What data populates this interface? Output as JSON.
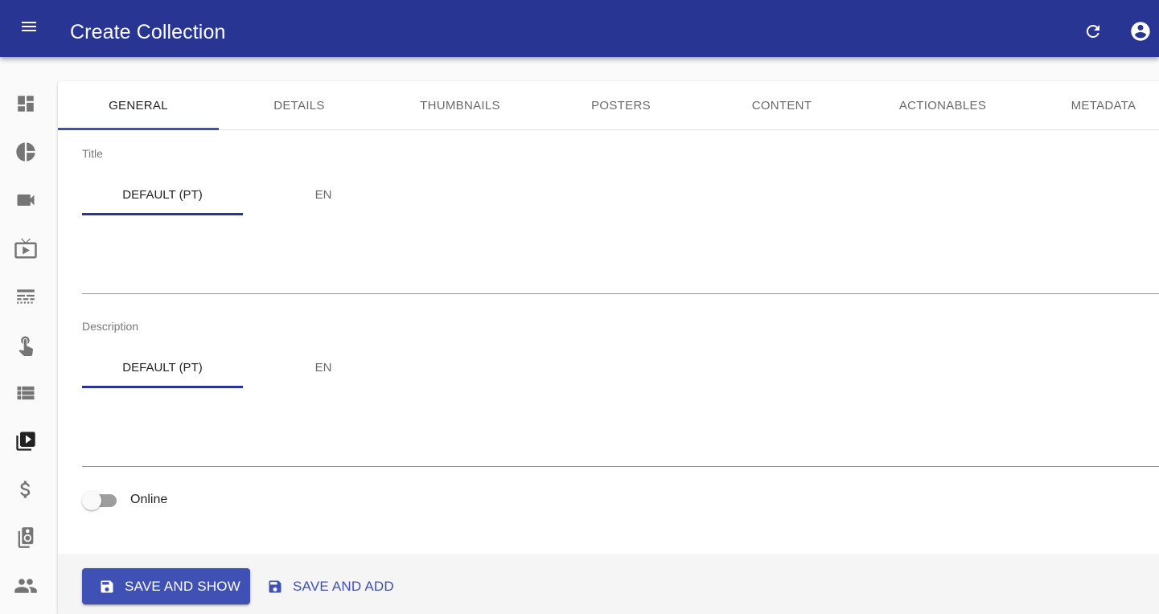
{
  "app_bar": {
    "title": "Create Collection",
    "menu_icon": "menu-icon",
    "refresh_icon": "refresh-icon",
    "account_icon": "account-circle-icon",
    "background_color": "#283593"
  },
  "sidebar": {
    "items": [
      {
        "icon": "dashboard-icon",
        "active": false
      },
      {
        "icon": "pie-chart-icon",
        "active": false
      },
      {
        "icon": "videocam-icon",
        "active": false
      },
      {
        "icon": "live-tv-icon",
        "active": false
      },
      {
        "icon": "subtitles-icon",
        "active": false
      },
      {
        "icon": "touch-app-icon",
        "active": false
      },
      {
        "icon": "view-list-icon",
        "active": false
      },
      {
        "icon": "video-library-icon",
        "active": true
      },
      {
        "icon": "dollar-icon",
        "active": false
      },
      {
        "icon": "speaker-group-icon",
        "active": false
      },
      {
        "icon": "people-icon",
        "active": false
      }
    ]
  },
  "tabs": {
    "active": "GENERAL",
    "items": [
      "GENERAL",
      "DETAILS",
      "THUMBNAILS",
      "POSTERS",
      "CONTENT",
      "ACTIONABLES",
      "METADATA"
    ]
  },
  "form": {
    "title_field": {
      "label": "Title",
      "language_tabs": [
        "DEFAULT (PT)",
        "EN"
      ],
      "active_language": "DEFAULT (PT)",
      "value": ""
    },
    "description_field": {
      "label": "Description",
      "language_tabs": [
        "DEFAULT (PT)",
        "EN"
      ],
      "active_language": "DEFAULT (PT)",
      "value": ""
    },
    "online_toggle": {
      "label": "Online",
      "checked": false
    }
  },
  "toolbar": {
    "save_and_show_label": "SAVE AND SHOW",
    "save_and_add_label": "SAVE AND ADD",
    "save_icon": "save-icon",
    "primary_color": "#3f51b5"
  }
}
